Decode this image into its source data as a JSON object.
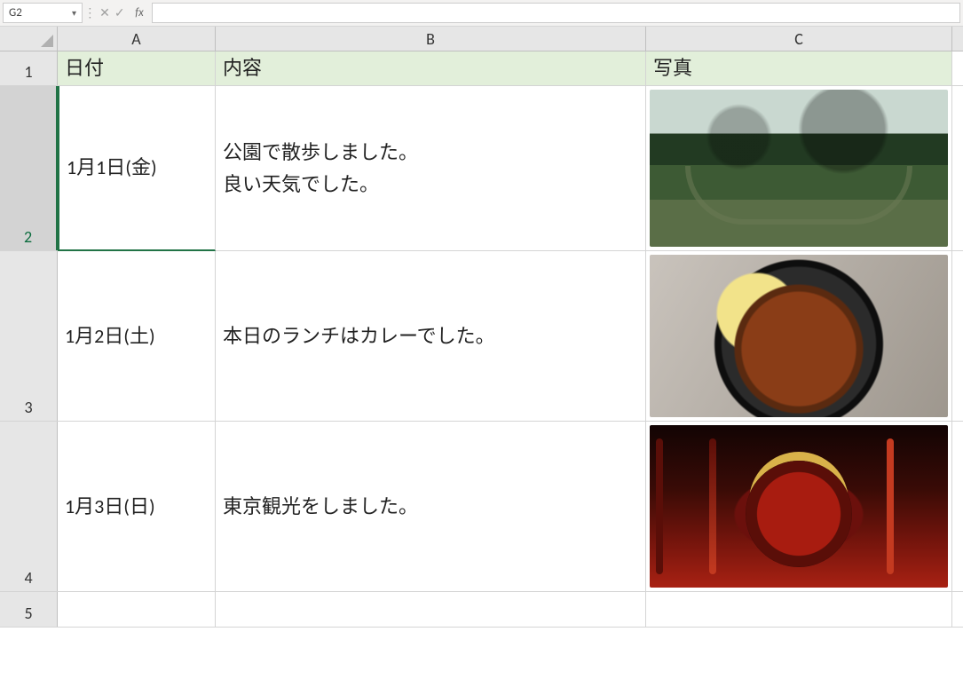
{
  "formula_bar": {
    "name_box_value": "G2",
    "formula_value": "",
    "fx_label": "fx"
  },
  "columns": {
    "A": "A",
    "B": "B",
    "C": "C"
  },
  "row_numbers": [
    "1",
    "2",
    "3",
    "4",
    "5"
  ],
  "headers": {
    "date": "日付",
    "content": "内容",
    "photo": "写真"
  },
  "rows": [
    {
      "date": "1月1日(金)",
      "content": "公園で散歩しました。\n良い天気でした。",
      "photo_desc": "park"
    },
    {
      "date": "1月2日(土)",
      "content": "本日のランチはカレーでした。",
      "photo_desc": "curry"
    },
    {
      "date": "1月3日(日)",
      "content": "東京観光をしました。",
      "photo_desc": "lantern"
    }
  ],
  "active_cell": "A2"
}
